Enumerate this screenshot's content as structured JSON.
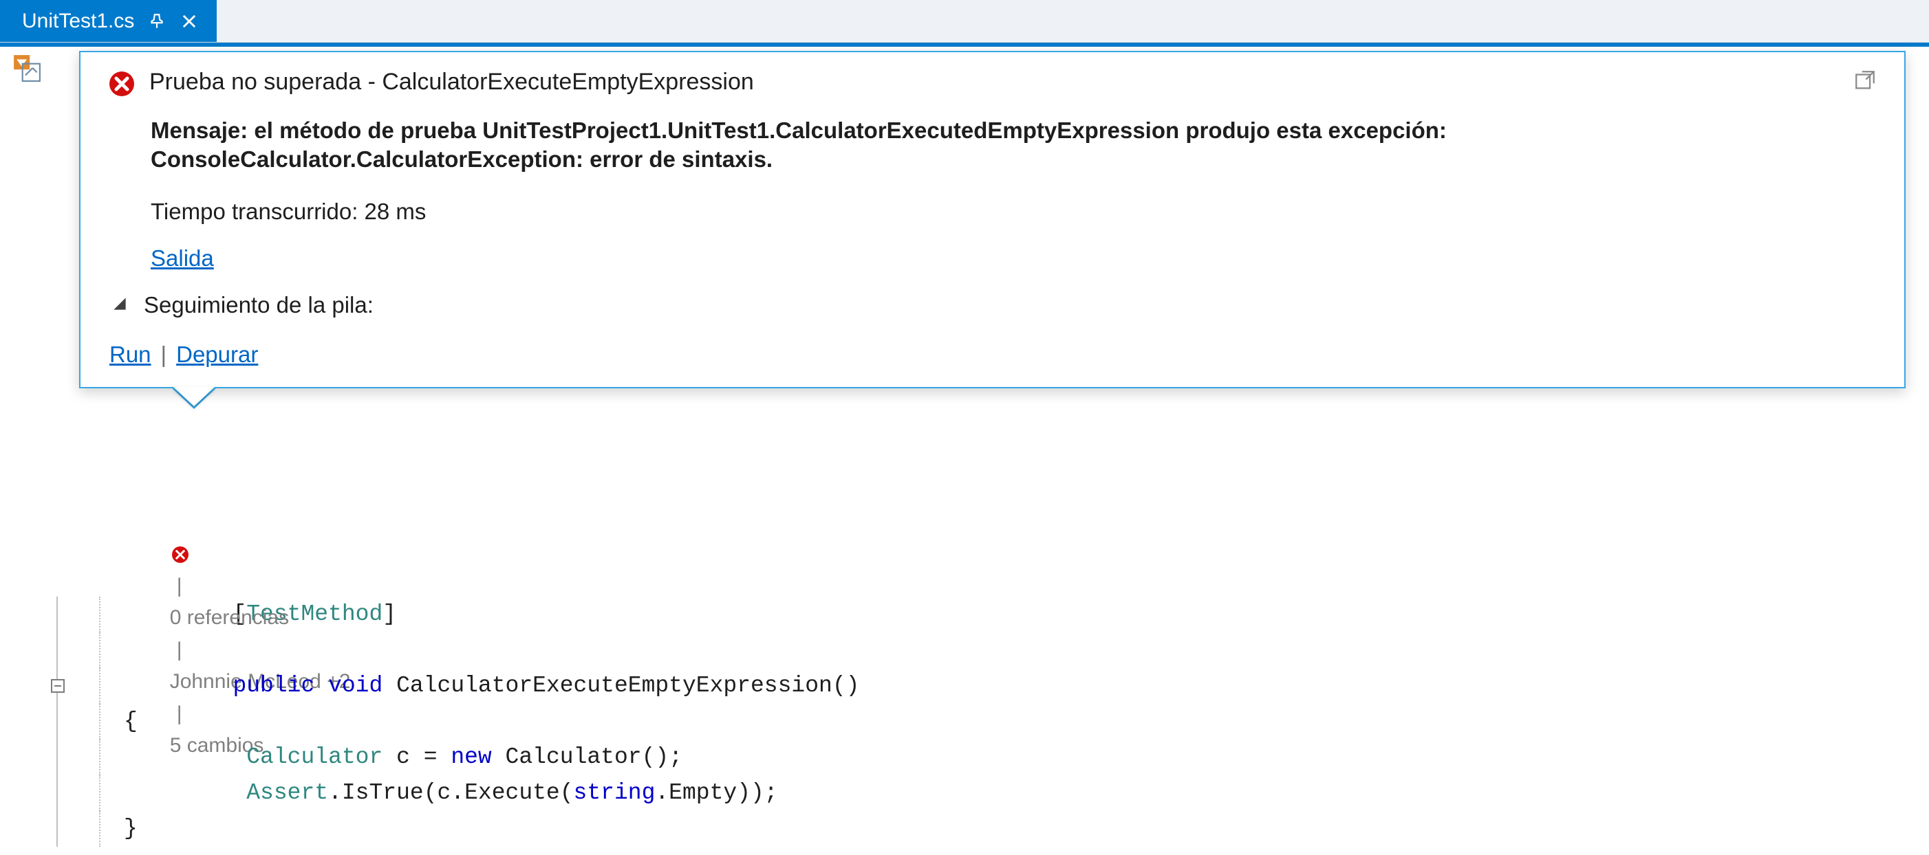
{
  "tab": {
    "filename": "UnitTest1.cs"
  },
  "popup": {
    "title": "Prueba no superada - CalculatorExecuteEmptyExpression",
    "message": "Mensaje: el método de prueba UnitTestProject1.UnitTest1.CalculatorExecutedEmptyExpression produjo esta excepción: ConsoleCalculator.CalculatorException: error de sintaxis.",
    "elapsed": "Tiempo transcurrido: 28 ms",
    "output_link": "Salida",
    "stack_label": "Seguimiento de la pila:",
    "run_label": "Run",
    "debug_label": "Depurar"
  },
  "codelens": {
    "refs": "0 referencias",
    "author": "Johnnie McLeod +2",
    "changes": "5 cambios"
  },
  "code": {
    "attr_open": "[",
    "attr_name": "TestMethod",
    "attr_close": "]",
    "kw_public": "public",
    "kw_void": "void",
    "method_name": "CalculatorExecuteEmptyExpression()",
    "brace_open": "{",
    "type_calc": "Calculator",
    "var_c": " c = ",
    "kw_new": "new",
    "ctor_call": " Calculator();",
    "type_assert": "Assert",
    "istrue": ".IsTrue(c.Execute(",
    "kw_string": "string",
    "empty_tail": ".Empty));",
    "brace_close": "}"
  }
}
